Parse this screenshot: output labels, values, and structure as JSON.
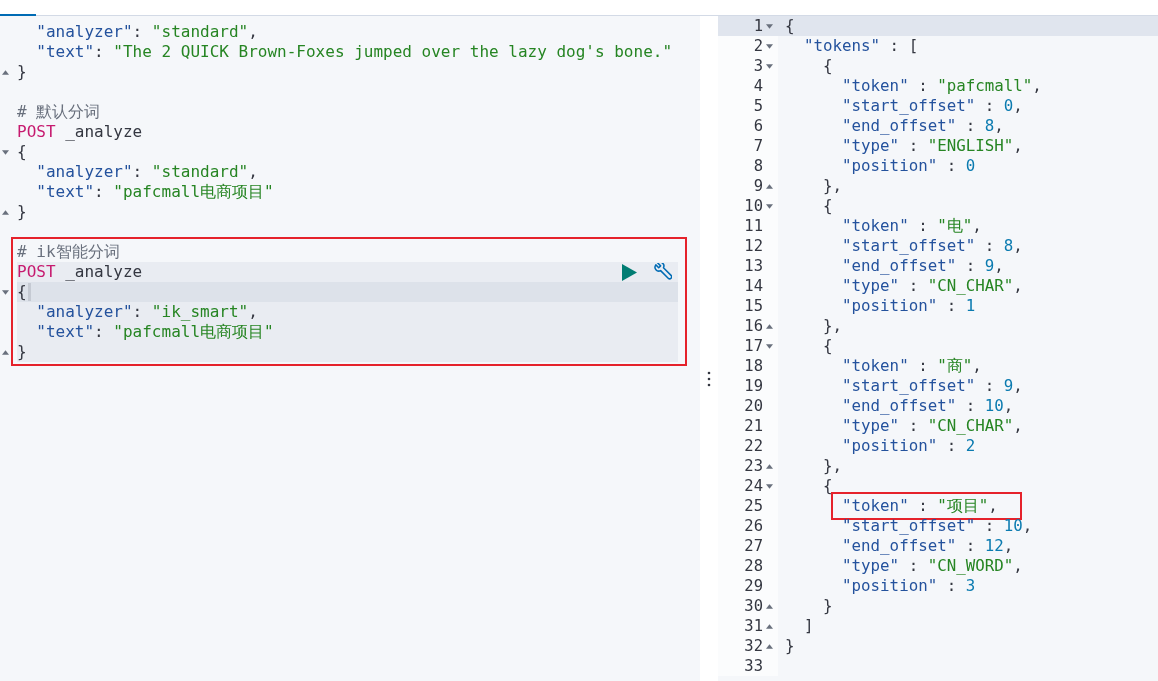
{
  "request_editor": {
    "blocks": [
      {
        "selected": false,
        "boxed": false,
        "lines": [
          {
            "opens": false,
            "closes": false,
            "current": false,
            "parts": [
              {
                "kind": "k",
                "text": "\"analyzer\""
              },
              {
                "kind": "p",
                "text": ": "
              },
              {
                "kind": "s",
                "text": "\"standard\""
              },
              {
                "kind": "p",
                "text": ","
              }
            ]
          },
          {
            "opens": false,
            "closes": false,
            "current": false,
            "parts": [
              {
                "kind": "k",
                "text": "\"text\""
              },
              {
                "kind": "p",
                "text": ": "
              },
              {
                "kind": "s",
                "text": "\"The 2 QUICK Brown-Foxes jumped over the lazy dog's bone.\""
              }
            ]
          },
          {
            "opens": false,
            "closes": true,
            "current": false,
            "parts": [
              {
                "kind": "p",
                "text": "}"
              }
            ]
          }
        ]
      },
      {
        "selected": false,
        "boxed": false,
        "comment": "# 默认分词",
        "method": "POST",
        "path": "_analyze",
        "lines": [
          {
            "opens": true,
            "closes": false,
            "current": false,
            "parts": [
              {
                "kind": "p",
                "text": "{"
              }
            ]
          },
          {
            "opens": false,
            "closes": false,
            "current": false,
            "parts": [
              {
                "kind": "k",
                "text": "\"analyzer\""
              },
              {
                "kind": "p",
                "text": ": "
              },
              {
                "kind": "s",
                "text": "\"standard\""
              },
              {
                "kind": "p",
                "text": ","
              }
            ]
          },
          {
            "opens": false,
            "closes": false,
            "current": false,
            "parts": [
              {
                "kind": "k",
                "text": "\"text\""
              },
              {
                "kind": "p",
                "text": ": "
              },
              {
                "kind": "s",
                "text": "\"pafcmall电商项目\""
              }
            ]
          },
          {
            "opens": false,
            "closes": true,
            "current": false,
            "parts": [
              {
                "kind": "p",
                "text": "}"
              }
            ]
          }
        ]
      },
      {
        "selected": true,
        "boxed": true,
        "comment": "# ik智能分词",
        "method": "POST",
        "path": "_analyze",
        "lines": [
          {
            "opens": true,
            "closes": false,
            "current": true,
            "parts": [
              {
                "kind": "p",
                "text": "{"
              }
            ]
          },
          {
            "opens": false,
            "closes": false,
            "current": false,
            "parts": [
              {
                "kind": "k",
                "text": "\"analyzer\""
              },
              {
                "kind": "p",
                "text": ": "
              },
              {
                "kind": "s",
                "text": "\"ik_smart\""
              },
              {
                "kind": "p",
                "text": ","
              }
            ]
          },
          {
            "opens": false,
            "closes": false,
            "current": false,
            "parts": [
              {
                "kind": "k",
                "text": "\"text\""
              },
              {
                "kind": "p",
                "text": ": "
              },
              {
                "kind": "s",
                "text": "\"pafcmall电商项目\""
              }
            ]
          },
          {
            "opens": false,
            "closes": true,
            "current": false,
            "parts": [
              {
                "kind": "p",
                "text": "}"
              }
            ]
          }
        ]
      }
    ]
  },
  "response": {
    "lines": [
      {
        "no": "1",
        "opens": true,
        "closes": false,
        "current": true,
        "boxed": false,
        "parts": [
          {
            "kind": "p",
            "text": "{"
          }
        ]
      },
      {
        "no": "2",
        "opens": true,
        "closes": false,
        "current": false,
        "boxed": false,
        "parts": [
          {
            "kind": "k",
            "text": "\"tokens\""
          },
          {
            "kind": "p",
            "text": " : ["
          }
        ]
      },
      {
        "no": "3",
        "opens": true,
        "closes": false,
        "current": false,
        "boxed": false,
        "parts": [
          {
            "kind": "p",
            "text": "{"
          }
        ]
      },
      {
        "no": "4",
        "opens": false,
        "closes": false,
        "current": false,
        "boxed": false,
        "parts": [
          {
            "kind": "k",
            "text": "\"token\""
          },
          {
            "kind": "p",
            "text": " : "
          },
          {
            "kind": "s",
            "text": "\"pafcmall\""
          },
          {
            "kind": "p",
            "text": ","
          }
        ]
      },
      {
        "no": "5",
        "opens": false,
        "closes": false,
        "current": false,
        "boxed": false,
        "parts": [
          {
            "kind": "k",
            "text": "\"start_offset\""
          },
          {
            "kind": "p",
            "text": " : "
          },
          {
            "kind": "n",
            "text": "0"
          },
          {
            "kind": "p",
            "text": ","
          }
        ]
      },
      {
        "no": "6",
        "opens": false,
        "closes": false,
        "current": false,
        "boxed": false,
        "parts": [
          {
            "kind": "k",
            "text": "\"end_offset\""
          },
          {
            "kind": "p",
            "text": " : "
          },
          {
            "kind": "n",
            "text": "8"
          },
          {
            "kind": "p",
            "text": ","
          }
        ]
      },
      {
        "no": "7",
        "opens": false,
        "closes": false,
        "current": false,
        "boxed": false,
        "parts": [
          {
            "kind": "k",
            "text": "\"type\""
          },
          {
            "kind": "p",
            "text": " : "
          },
          {
            "kind": "s",
            "text": "\"ENGLISH\""
          },
          {
            "kind": "p",
            "text": ","
          }
        ]
      },
      {
        "no": "8",
        "opens": false,
        "closes": false,
        "current": false,
        "boxed": false,
        "parts": [
          {
            "kind": "k",
            "text": "\"position\""
          },
          {
            "kind": "p",
            "text": " : "
          },
          {
            "kind": "n",
            "text": "0"
          }
        ]
      },
      {
        "no": "9",
        "opens": false,
        "closes": true,
        "current": false,
        "boxed": false,
        "parts": [
          {
            "kind": "p",
            "text": "},"
          }
        ]
      },
      {
        "no": "10",
        "opens": true,
        "closes": false,
        "current": false,
        "boxed": false,
        "parts": [
          {
            "kind": "p",
            "text": "{"
          }
        ]
      },
      {
        "no": "11",
        "opens": false,
        "closes": false,
        "current": false,
        "boxed": false,
        "parts": [
          {
            "kind": "k",
            "text": "\"token\""
          },
          {
            "kind": "p",
            "text": " : "
          },
          {
            "kind": "s",
            "text": "\"电\""
          },
          {
            "kind": "p",
            "text": ","
          }
        ]
      },
      {
        "no": "12",
        "opens": false,
        "closes": false,
        "current": false,
        "boxed": false,
        "parts": [
          {
            "kind": "k",
            "text": "\"start_offset\""
          },
          {
            "kind": "p",
            "text": " : "
          },
          {
            "kind": "n",
            "text": "8"
          },
          {
            "kind": "p",
            "text": ","
          }
        ]
      },
      {
        "no": "13",
        "opens": false,
        "closes": false,
        "current": false,
        "boxed": false,
        "parts": [
          {
            "kind": "k",
            "text": "\"end_offset\""
          },
          {
            "kind": "p",
            "text": " : "
          },
          {
            "kind": "n",
            "text": "9"
          },
          {
            "kind": "p",
            "text": ","
          }
        ]
      },
      {
        "no": "14",
        "opens": false,
        "closes": false,
        "current": false,
        "boxed": false,
        "parts": [
          {
            "kind": "k",
            "text": "\"type\""
          },
          {
            "kind": "p",
            "text": " : "
          },
          {
            "kind": "s",
            "text": "\"CN_CHAR\""
          },
          {
            "kind": "p",
            "text": ","
          }
        ]
      },
      {
        "no": "15",
        "opens": false,
        "closes": false,
        "current": false,
        "boxed": false,
        "parts": [
          {
            "kind": "k",
            "text": "\"position\""
          },
          {
            "kind": "p",
            "text": " : "
          },
          {
            "kind": "n",
            "text": "1"
          }
        ]
      },
      {
        "no": "16",
        "opens": false,
        "closes": true,
        "current": false,
        "boxed": false,
        "parts": [
          {
            "kind": "p",
            "text": "},"
          }
        ]
      },
      {
        "no": "17",
        "opens": true,
        "closes": false,
        "current": false,
        "boxed": false,
        "parts": [
          {
            "kind": "p",
            "text": "{"
          }
        ]
      },
      {
        "no": "18",
        "opens": false,
        "closes": false,
        "current": false,
        "boxed": false,
        "parts": [
          {
            "kind": "k",
            "text": "\"token\""
          },
          {
            "kind": "p",
            "text": " : "
          },
          {
            "kind": "s",
            "text": "\"商\""
          },
          {
            "kind": "p",
            "text": ","
          }
        ]
      },
      {
        "no": "19",
        "opens": false,
        "closes": false,
        "current": false,
        "boxed": false,
        "parts": [
          {
            "kind": "k",
            "text": "\"start_offset\""
          },
          {
            "kind": "p",
            "text": " : "
          },
          {
            "kind": "n",
            "text": "9"
          },
          {
            "kind": "p",
            "text": ","
          }
        ]
      },
      {
        "no": "20",
        "opens": false,
        "closes": false,
        "current": false,
        "boxed": false,
        "parts": [
          {
            "kind": "k",
            "text": "\"end_offset\""
          },
          {
            "kind": "p",
            "text": " : "
          },
          {
            "kind": "n",
            "text": "10"
          },
          {
            "kind": "p",
            "text": ","
          }
        ]
      },
      {
        "no": "21",
        "opens": false,
        "closes": false,
        "current": false,
        "boxed": false,
        "parts": [
          {
            "kind": "k",
            "text": "\"type\""
          },
          {
            "kind": "p",
            "text": " : "
          },
          {
            "kind": "s",
            "text": "\"CN_CHAR\""
          },
          {
            "kind": "p",
            "text": ","
          }
        ]
      },
      {
        "no": "22",
        "opens": false,
        "closes": false,
        "current": false,
        "boxed": false,
        "parts": [
          {
            "kind": "k",
            "text": "\"position\""
          },
          {
            "kind": "p",
            "text": " : "
          },
          {
            "kind": "n",
            "text": "2"
          }
        ]
      },
      {
        "no": "23",
        "opens": false,
        "closes": true,
        "current": false,
        "boxed": false,
        "parts": [
          {
            "kind": "p",
            "text": "},"
          }
        ]
      },
      {
        "no": "24",
        "opens": true,
        "closes": false,
        "current": false,
        "boxed": false,
        "parts": [
          {
            "kind": "p",
            "text": "{"
          }
        ]
      },
      {
        "no": "25",
        "opens": false,
        "closes": false,
        "current": false,
        "boxed": true,
        "parts": [
          {
            "kind": "k",
            "text": "\"token\""
          },
          {
            "kind": "p",
            "text": " : "
          },
          {
            "kind": "s",
            "text": "\"项目\""
          },
          {
            "kind": "p",
            "text": ","
          }
        ]
      },
      {
        "no": "26",
        "opens": false,
        "closes": false,
        "current": false,
        "boxed": false,
        "parts": [
          {
            "kind": "k",
            "text": "\"start_offset\""
          },
          {
            "kind": "p",
            "text": " : "
          },
          {
            "kind": "n",
            "text": "10"
          },
          {
            "kind": "p",
            "text": ","
          }
        ]
      },
      {
        "no": "27",
        "opens": false,
        "closes": false,
        "current": false,
        "boxed": false,
        "parts": [
          {
            "kind": "k",
            "text": "\"end_offset\""
          },
          {
            "kind": "p",
            "text": " : "
          },
          {
            "kind": "n",
            "text": "12"
          },
          {
            "kind": "p",
            "text": ","
          }
        ]
      },
      {
        "no": "28",
        "opens": false,
        "closes": false,
        "current": false,
        "boxed": false,
        "parts": [
          {
            "kind": "k",
            "text": "\"type\""
          },
          {
            "kind": "p",
            "text": " : "
          },
          {
            "kind": "s",
            "text": "\"CN_WORD\""
          },
          {
            "kind": "p",
            "text": ","
          }
        ]
      },
      {
        "no": "29",
        "opens": false,
        "closes": false,
        "current": false,
        "boxed": false,
        "parts": [
          {
            "kind": "k",
            "text": "\"position\""
          },
          {
            "kind": "p",
            "text": " : "
          },
          {
            "kind": "n",
            "text": "3"
          }
        ]
      },
      {
        "no": "30",
        "opens": false,
        "closes": true,
        "current": false,
        "boxed": false,
        "parts": [
          {
            "kind": "p",
            "text": "}"
          }
        ]
      },
      {
        "no": "31",
        "opens": false,
        "closes": true,
        "current": false,
        "boxed": false,
        "parts": [
          {
            "kind": "p",
            "text": "]"
          }
        ]
      },
      {
        "no": "32",
        "opens": false,
        "closes": true,
        "current": false,
        "boxed": false,
        "parts": [
          {
            "kind": "p",
            "text": "}"
          }
        ]
      },
      {
        "no": "33"
      }
    ]
  }
}
